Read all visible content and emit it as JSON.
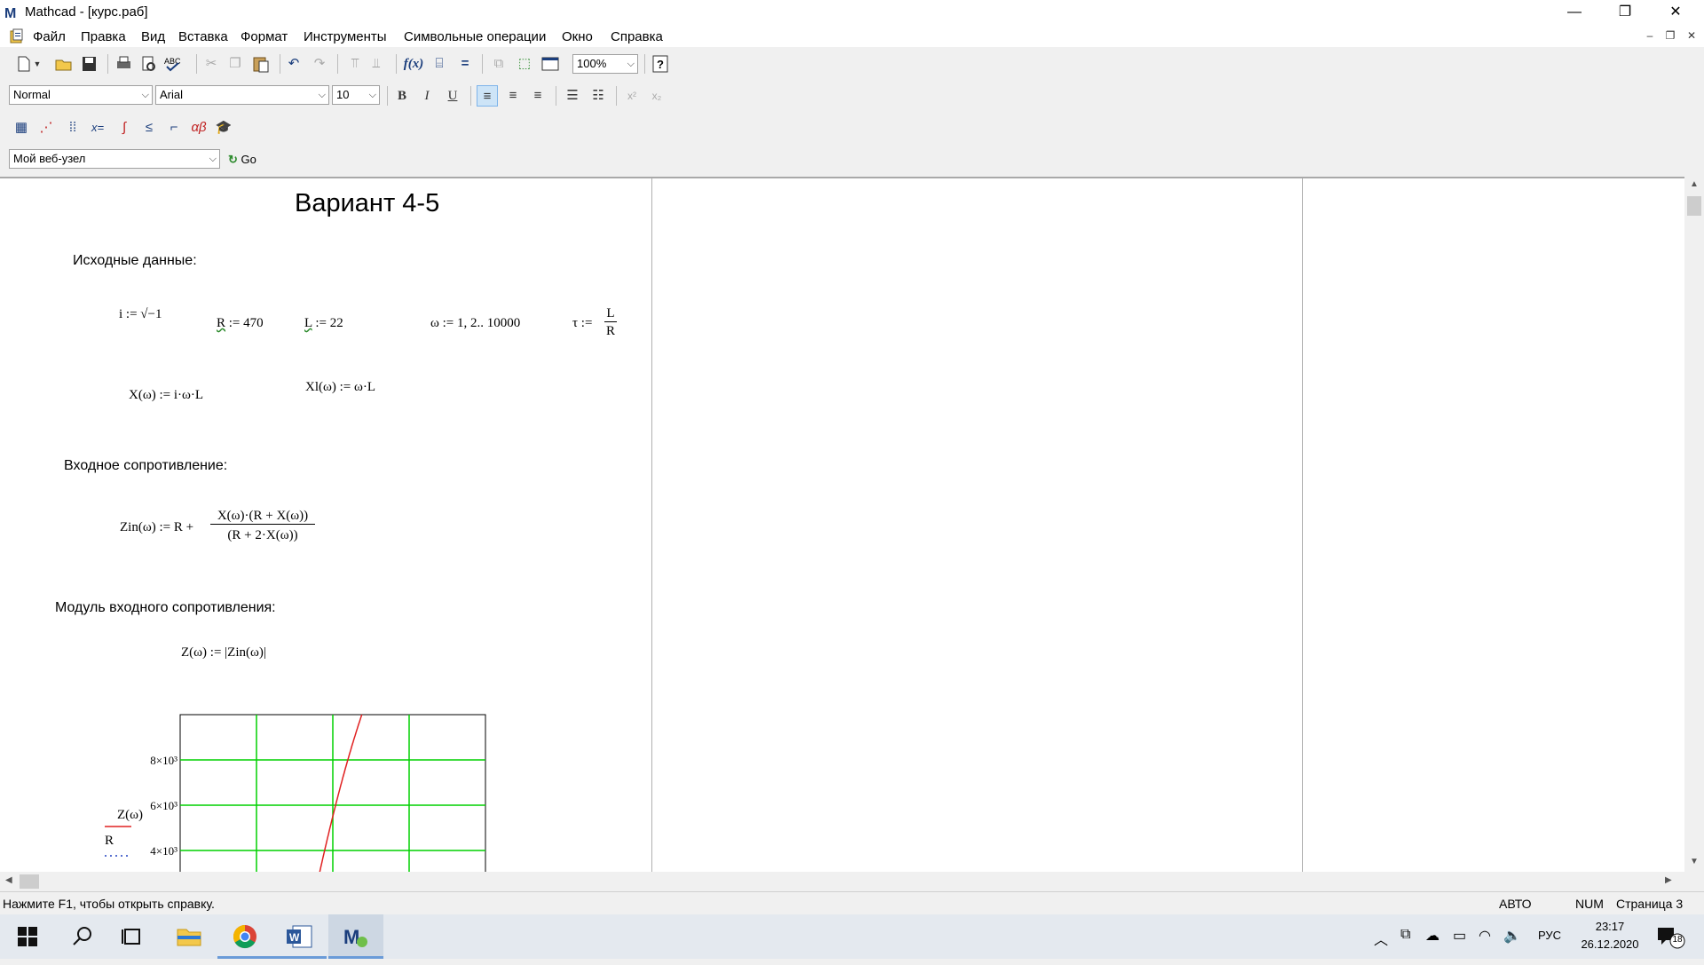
{
  "window": {
    "title": "Mathcad - [курс.раб]",
    "minimize_glyph": "—",
    "restore_glyph": "❐",
    "close_glyph": "✕"
  },
  "menu": [
    "Файл",
    "Правка",
    "Вид",
    "Вставка",
    "Формат",
    "Инструменты",
    "Символьные операции",
    "Окно",
    "Справка"
  ],
  "toolbar": {
    "zoom": "100%",
    "style": "Normal",
    "font": "Arial",
    "size": "10",
    "bold": "B",
    "italic": "I",
    "underline": "U",
    "web_address": "Мой веб-узел",
    "go_label": "Go"
  },
  "document": {
    "heading": "Вариант 4-5",
    "source_data_label": "Исходные данные:",
    "def_i": "i := √−1",
    "def_R_name": "R",
    "def_R_value": " := 470",
    "def_L_name": "L",
    "def_L_value": " := 22",
    "def_omega": "ω := 1, 2.. 10000",
    "def_tau": "τ :=",
    "tau_num": "L",
    "tau_den": "R",
    "def_X": "X(ω) := i·ω·L",
    "def_Xl": "Xl(ω) := ω·L",
    "input_impedance_label": "Входное сопротивление:",
    "zin_lhs": "Zin(ω) := R +",
    "zin_num": "X(ω)·(R + X(ω))",
    "zin_den": "(R + 2·X(ω))",
    "modulus_label": "Модуль входного сопротивления:",
    "def_Z": "Z(ω) := |Zin(ω)|"
  },
  "chart_data": {
    "type": "line",
    "y_tick_labels": [
      "8×10³",
      "6×10³",
      "4×10³"
    ],
    "legend_top": "Z(ω)",
    "legend_bottom": "R",
    "series": [
      {
        "name": "Z(ω)",
        "color": "#e02020",
        "style": "solid"
      },
      {
        "name": "R",
        "color": "#2040c0",
        "style": "dotted"
      }
    ],
    "grid": true,
    "grid_color": "#00d000"
  },
  "status": {
    "help": "Нажмите F1, чтобы открыть справку.",
    "mode": "АВТО",
    "num": "NUM",
    "page": "Страница 3"
  },
  "taskbar": {
    "lang": "РУС",
    "time": "23:17",
    "date": "26.12.2020",
    "notifications": "18"
  },
  "colors": {
    "grid": "#00d000",
    "curve": "#e02020",
    "word_blue": "#2b579a",
    "taskbar_bg": "#e4e9ef"
  }
}
